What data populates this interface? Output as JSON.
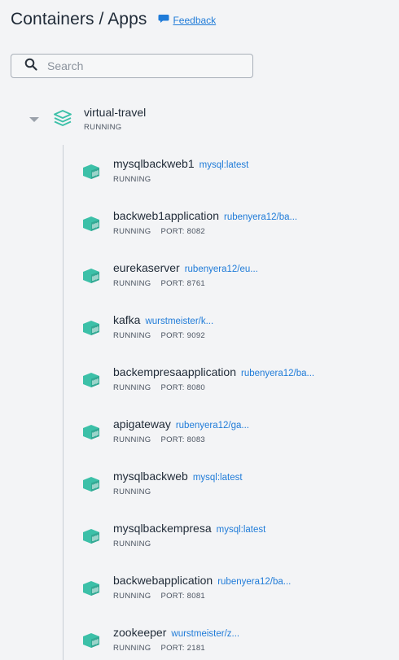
{
  "header": {
    "title": "Containers / Apps",
    "feedback_label": "Feedback"
  },
  "search": {
    "placeholder": "Search",
    "value": ""
  },
  "colors": {
    "accent": "#1f7bd8",
    "container_icon": "#3cc0a8",
    "background": "#f3f4f6"
  },
  "group": {
    "name": "virtual-travel",
    "status": "RUNNING",
    "icon": "stack-icon",
    "expanded": true
  },
  "containers": [
    {
      "name": "mysqlbackweb1",
      "image": "mysql:latest",
      "status": "RUNNING",
      "port": ""
    },
    {
      "name": "backweb1application",
      "image": "rubenyera12/ba...",
      "status": "RUNNING",
      "port": "PORT: 8082"
    },
    {
      "name": "eurekaserver",
      "image": "rubenyera12/eu...",
      "status": "RUNNING",
      "port": "PORT: 8761"
    },
    {
      "name": "kafka",
      "image": "wurstmeister/k...",
      "status": "RUNNING",
      "port": "PORT: 9092"
    },
    {
      "name": "backempresaapplication",
      "image": "rubenyera12/ba...",
      "status": "RUNNING",
      "port": "PORT: 8080"
    },
    {
      "name": "apigateway",
      "image": "rubenyera12/ga...",
      "status": "RUNNING",
      "port": "PORT: 8083"
    },
    {
      "name": "mysqlbackweb",
      "image": "mysql:latest",
      "status": "RUNNING",
      "port": ""
    },
    {
      "name": "mysqlbackempresa",
      "image": "mysql:latest",
      "status": "RUNNING",
      "port": ""
    },
    {
      "name": "backwebapplication",
      "image": "rubenyera12/ba...",
      "status": "RUNNING",
      "port": "PORT: 8081"
    },
    {
      "name": "zookeeper",
      "image": "wurstmeister/z...",
      "status": "RUNNING",
      "port": "PORT: 2181"
    }
  ]
}
